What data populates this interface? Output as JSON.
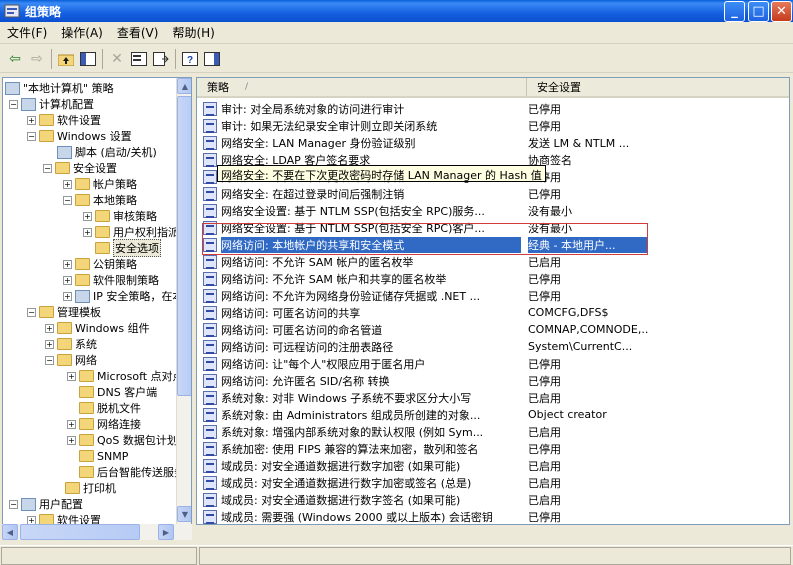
{
  "window": {
    "title": "组策略"
  },
  "menu": [
    "文件(F)",
    "操作(A)",
    "查看(V)",
    "帮助(H)"
  ],
  "toolbar": {
    "icons": [
      "back-icon",
      "forward-icon",
      "up-folder-icon",
      "show-hide-tree-icon",
      "delete-icon",
      "properties-icon",
      "export-list-icon",
      "help-icon",
      "show-hide-action-pane-icon"
    ]
  },
  "tree": {
    "items": [
      {
        "label": "\"本地计算机\" 策略"
      },
      {
        "label": "计算机配置"
      },
      {
        "label": "软件设置"
      },
      {
        "label": "Windows 设置"
      },
      {
        "label": "脚本 (启动/关机)"
      },
      {
        "label": "安全设置"
      },
      {
        "label": "帐户策略"
      },
      {
        "label": "本地策略"
      },
      {
        "label": "审核策略"
      },
      {
        "label": "用户权利指派"
      },
      {
        "label": "安全选项"
      },
      {
        "label": "公钥策略"
      },
      {
        "label": "软件限制策略"
      },
      {
        "label": "IP 安全策略，在本地计算机"
      },
      {
        "label": "管理模板"
      },
      {
        "label": "Windows 组件"
      },
      {
        "label": "系统"
      },
      {
        "label": "网络"
      },
      {
        "label": "Microsoft 点对点网络服务"
      },
      {
        "label": "DNS 客户端"
      },
      {
        "label": "脱机文件"
      },
      {
        "label": "网络连接"
      },
      {
        "label": "QoS 数据包计划程序"
      },
      {
        "label": "SNMP"
      },
      {
        "label": "后台智能传送服务"
      },
      {
        "label": "打印机"
      },
      {
        "label": "用户配置"
      },
      {
        "label": "软件设置"
      }
    ]
  },
  "list": {
    "headers": {
      "policy": "策略",
      "setting": "安全设置"
    },
    "tooltip": "网络安全: 不要在下次更改密码时存储 LAN Manager 的 Hash 值",
    "rows": [
      {
        "policy": "审计: 对全局系统对象的访问进行审计",
        "setting": "已停用"
      },
      {
        "policy": "审计: 如果无法纪录安全审计则立即关闭系统",
        "setting": "已停用"
      },
      {
        "policy": "网络安全: LAN Manager 身份验证级别",
        "setting": "发送 LM & NTLM ..."
      },
      {
        "policy": "网络安全: LDAP 客户签名要求",
        "setting": "协商签名"
      },
      {
        "policy": "网络安全: 不要在下次更改密码时存储 LAN Manager 的 Hash 值",
        "setting": "已停用"
      },
      {
        "policy": "网络安全: 在超过登录时间后强制注销",
        "setting": "已停用"
      },
      {
        "policy": "网络安全设置: 基于 NTLM SSP(包括安全 RPC)服务...",
        "setting": "没有最小"
      },
      {
        "policy": "网络安全设置: 基于 NTLM SSP(包括安全 RPC)客户...",
        "setting": "没有最小"
      },
      {
        "policy": "网络访问: 本地帐户的共享和安全模式",
        "setting": "经典 - 本地用户..."
      },
      {
        "policy": "网络访问: 不允许 SAM 帐户的匿名枚举",
        "setting": "已启用"
      },
      {
        "policy": "网络访问: 不允许 SAM 帐户和共享的匿名枚举",
        "setting": "已停用"
      },
      {
        "policy": "网络访问: 不允许为网络身份验证储存凭据或 .NET ...",
        "setting": "已停用"
      },
      {
        "policy": "网络访问: 可匿名访问的共享",
        "setting": "COMCFG,DFS$"
      },
      {
        "policy": "网络访问: 可匿名访问的命名管道",
        "setting": "COMNAP,COMNODE,..."
      },
      {
        "policy": "网络访问: 可远程访问的注册表路径",
        "setting": "System\\CurrentC..."
      },
      {
        "policy": "网络访问: 让\"每个人\"权限应用于匿名用户",
        "setting": "已停用"
      },
      {
        "policy": "网络访问: 允许匿名 SID/名称 转换",
        "setting": "已停用"
      },
      {
        "policy": "系统对象: 对非 Windows 子系统不要求区分大小写",
        "setting": "已启用"
      },
      {
        "policy": "系统对象: 由 Administrators 组成员所创建的对象...",
        "setting": "Object creator"
      },
      {
        "policy": "系统对象: 增强内部系统对象的默认权限 (例如 Sym...",
        "setting": "已启用"
      },
      {
        "policy": "系统加密: 使用 FIPS 兼容的算法来加密，散列和签名",
        "setting": "已停用"
      },
      {
        "policy": "域成员: 对安全通道数据进行数字加密 (如果可能)",
        "setting": "已启用"
      },
      {
        "policy": "域成员: 对安全通道数据进行数字加密或签名 (总是)",
        "setting": "已启用"
      },
      {
        "policy": "域成员: 对安全通道数据进行数字签名 (如果可能)",
        "setting": "已启用"
      },
      {
        "policy": "域成员: 需要强 (Windows 2000 或以上版本) 会话密钥",
        "setting": "已停用"
      },
      {
        "policy": "域控制器: LDAP 服务器签名要求",
        "setting": "没有定义"
      }
    ]
  }
}
